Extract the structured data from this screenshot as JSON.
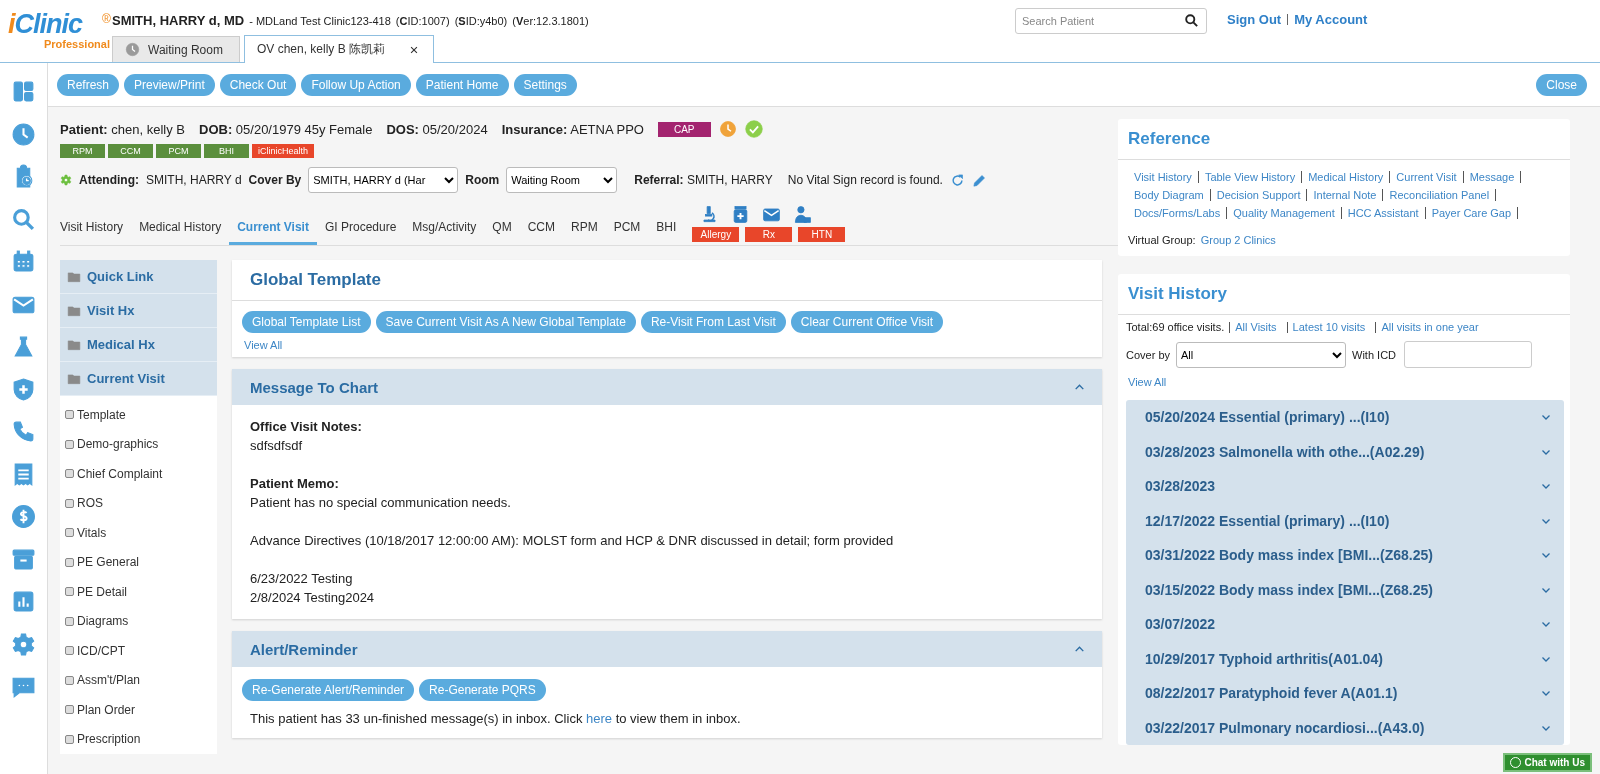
{
  "header": {
    "logo": {
      "name": "iClinic",
      "reg": "®",
      "tagline": "Professional"
    },
    "user": {
      "name": "SMITH, HARRY d, MD",
      "clinic": "- MDLand Test Clinic123-418",
      "ids": [
        "(**C**ID:1007)",
        "(**S**ID:y4b0)",
        "(**V**er:12.3.1801)"
      ]
    },
    "tabs": [
      {
        "label": "Waiting Room",
        "selected": false,
        "kind": "waiting"
      },
      {
        "label": "OV chen, kelly B 陈凯莉",
        "selected": true,
        "kind": "visit"
      }
    ],
    "search": {
      "placeholder": "Search Patient"
    },
    "links": [
      "Sign Out",
      "My Account"
    ]
  },
  "side_rail": [
    {
      "kind": "dashboard"
    },
    {
      "kind": "clock"
    },
    {
      "kind": "clipboard"
    },
    {
      "kind": "search"
    },
    {
      "kind": "calendar"
    },
    {
      "kind": "mail"
    },
    {
      "kind": "flask"
    },
    {
      "kind": "shield"
    },
    {
      "kind": "phone"
    },
    {
      "kind": "receipt"
    },
    {
      "kind": "dollar"
    },
    {
      "kind": "archive"
    },
    {
      "kind": "chart"
    },
    {
      "kind": "gear"
    },
    {
      "kind": "chat"
    }
  ],
  "toolbar": {
    "buttons": [
      "Refresh",
      "Preview/Print",
      "Check Out",
      "Follow Up Action",
      "Patient Home",
      "Settings"
    ],
    "close": "Close"
  },
  "patient": {
    "fields": [
      "**Patient:** chen, kelly B",
      "**DOB:** 05/20/1979 45y Female",
      "**DOS:** 05/20/2024",
      "**Insurance:** AETNA PPO"
    ],
    "badge": "CAP",
    "status_icons": [
      {
        "kind": "clock",
        "color": "#f0a33a"
      },
      {
        "kind": "check",
        "color": "#8ccf4a"
      }
    ],
    "programs": [
      {
        "label": "RPM",
        "color": "#5b8f3d"
      },
      {
        "label": "CCM",
        "color": "#5b8f3d"
      },
      {
        "label": "PCM",
        "color": "#5b8f3d"
      },
      {
        "label": "BHI",
        "color": "#5b8f3d"
      },
      {
        "label": "iClinicHealth",
        "color": "#e8462a"
      }
    ],
    "attending": {
      "label": "Attending:",
      "value": "SMITH, HARRY d"
    },
    "cover_by": {
      "label": "Cover By",
      "value": "SMITH, HARRY d (Har"
    },
    "room": {
      "label": "Room",
      "value": "Waiting Room"
    },
    "referral": "**Referral:** SMITH, HARRY",
    "vital_note": "No Vital Sign record is found."
  },
  "nav_tabs": [
    {
      "label": "Visit History",
      "selected": false
    },
    {
      "label": "Medical History",
      "selected": false
    },
    {
      "label": "Current Visit",
      "selected": true
    },
    {
      "label": "GI Procedure",
      "selected": false
    },
    {
      "label": "Msg/Activity",
      "selected": false
    },
    {
      "label": "QM",
      "selected": false
    },
    {
      "label": "CCM",
      "selected": false
    },
    {
      "label": "RPM",
      "selected": false
    },
    {
      "label": "PCM",
      "selected": false
    },
    {
      "label": "BHI",
      "selected": false
    }
  ],
  "quick_icons": [
    {
      "kind": "microscope"
    },
    {
      "kind": "medkit"
    },
    {
      "kind": "mail"
    },
    {
      "kind": "person"
    }
  ],
  "alert_tags": [
    "Allergy",
    "Rx",
    "HTN"
  ],
  "left_nav": {
    "folders": [
      "Quick Link",
      "Visit Hx",
      "Medical Hx",
      "Current Visit"
    ],
    "items": [
      "Template",
      "Demo-graphics",
      "Chief Complaint",
      "ROS",
      "Vitals",
      "PE General",
      "PE Detail",
      "Diagrams",
      "ICD/CPT",
      "Assm't/Plan",
      "Plan Order",
      "Prescription"
    ]
  },
  "global_template": {
    "title": "Global Template",
    "buttons": [
      "Global Template List",
      "Save Current Visit As A New Global Template",
      "Re-Visit From Last Visit",
      "Clear Current Office Visit"
    ],
    "view_all": "View All"
  },
  "message_to_chart": {
    "title": "Message To Chart",
    "expanded": true,
    "blocks": [
      {
        "heading": "Office Visit Notes:",
        "lines": [
          "sdfsdfsdf"
        ]
      },
      {
        "heading": "Patient Memo:",
        "lines": [
          "Patient has no special communication needs."
        ]
      },
      {
        "lines": [
          "Advance Directives (10/18/2017 12:00:00 AM): MOLST form and HCP & DNR discussed in detail; form provided"
        ]
      },
      {
        "lines": [
          "6/23/2022 Testing",
          "2/8/2024 Testing2024"
        ]
      }
    ]
  },
  "alert_reminder": {
    "title": "Alert/Reminder",
    "expanded": true,
    "buttons": [
      "Re-Generate Alert/Reminder",
      "Re-Generate PQRS"
    ],
    "text_before": "This patient has 33 un-finished message(s) in inbox. Click",
    "link": "here",
    "text_after": "to view them in inbox."
  },
  "reference": {
    "title": "Reference",
    "links": [
      "Visit History",
      "Table View History",
      "Medical History",
      "Current Visit",
      "Message",
      "Body Diagram",
      "Decision Support",
      "Internal Note",
      "Reconciliation Panel",
      "Docs/Forms/Labs",
      "Quality Management",
      "HCC Assistant",
      "Payer Care Gap"
    ],
    "virtual_group": {
      "label": "Virtual Group:",
      "value": "Group 2 Clinics"
    }
  },
  "visit_history": {
    "title": "Visit History",
    "total": "Total:69 office visits.",
    "links": [
      "All Visits",
      "Latest 10 visits",
      "All visits in one year"
    ],
    "cover_by": {
      "label": "Cover by",
      "value": "All"
    },
    "with_icd": {
      "label": "With ICD"
    },
    "view_all": "View All",
    "visits": [
      {
        "label": "05/20/2024 Essential (primary) ...(I10)",
        "expanded": false
      },
      {
        "label": "03/28/2023 Salmonella with othe...(A02.29)",
        "expanded": false
      },
      {
        "label": "03/28/2023",
        "expanded": false
      },
      {
        "label": "12/17/2022 Essential (primary) ...(I10)",
        "expanded": false
      },
      {
        "label": "03/31/2022 Body mass index [BMI...(Z68.25)",
        "expanded": false
      },
      {
        "label": "03/15/2022 Body mass index [BMI...(Z68.25)",
        "expanded": false
      },
      {
        "label": "03/07/2022",
        "expanded": false
      },
      {
        "label": "10/29/2017 Typhoid arthritis(A01.04)",
        "expanded": false
      },
      {
        "label": "08/22/2017 Paratyphoid fever A(A01.1)",
        "expanded": false
      },
      {
        "label": "03/22/2017 Pulmonary nocardiosi...(A43.0)",
        "expanded": false
      }
    ]
  },
  "chat_button": "Chat with Us"
}
